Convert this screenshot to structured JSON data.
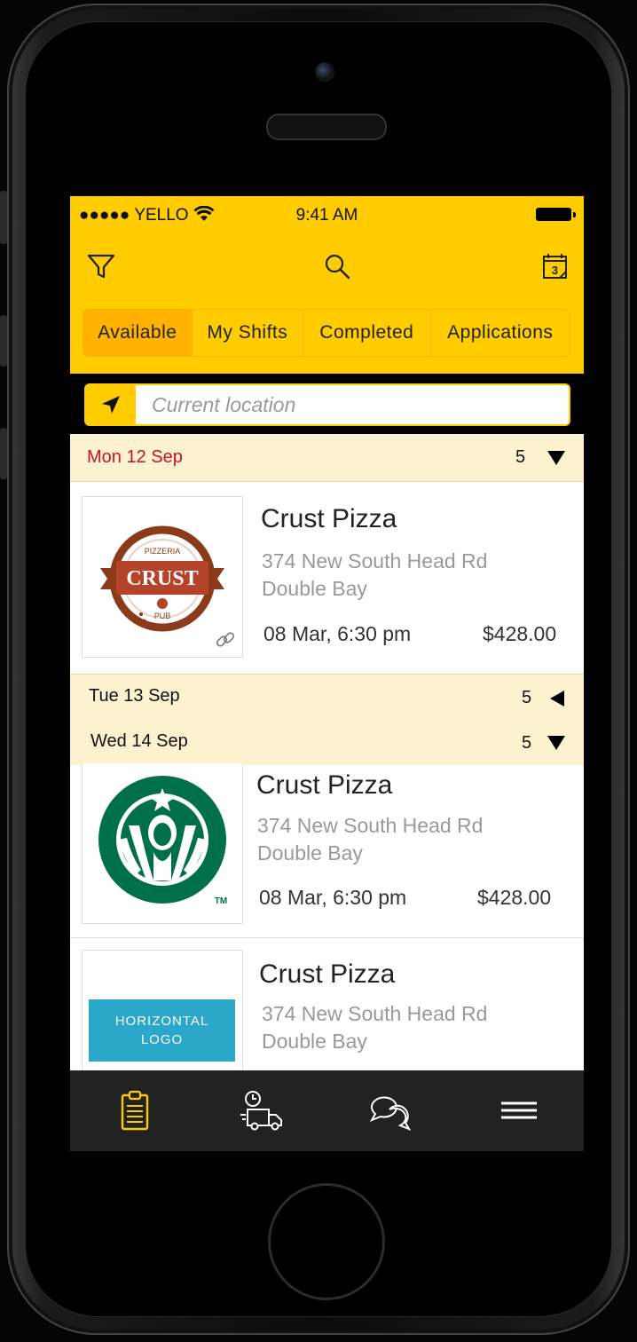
{
  "status_bar": {
    "carrier": "●●●●● YELLO",
    "time": "9:41 AM"
  },
  "toolbar": {
    "filter_icon": "filter-icon",
    "search_icon": "search-icon",
    "calendar_icon": "calendar-icon",
    "calendar_day": "3"
  },
  "tabs": [
    {
      "label": "Available",
      "active": true
    },
    {
      "label": "My Shifts",
      "active": false
    },
    {
      "label": "Completed",
      "active": false
    },
    {
      "label": "Applications",
      "active": false
    }
  ],
  "location": {
    "placeholder": "Current location"
  },
  "days": [
    {
      "label": "Mon 12 Sep",
      "count": "5",
      "expanded": true,
      "highlight": true
    },
    {
      "label": "Tue 13 Sep",
      "count": "5",
      "expanded": false,
      "highlight": false
    },
    {
      "label": "Wed 14 Sep",
      "count": "5",
      "expanded": true,
      "highlight": false
    }
  ],
  "shifts": [
    {
      "logo": "crust-pizza-logo",
      "logo_text": {
        "top": "PIZZERIA",
        "main": "CRUST",
        "bottom": "PUB"
      },
      "title": "Crust Pizza",
      "address_line1": "374 New South Head Rd",
      "address_line2": "Double Bay",
      "date": "08 Mar, 6:30 pm",
      "price": "$428.00",
      "linked": true
    },
    {
      "logo": "starbucks-logo",
      "logo_tm": "TM",
      "title": "Crust Pizza",
      "address_line1": "374 New South Head Rd",
      "address_line2": "Double Bay",
      "date": "08 Mar, 6:30 pm",
      "price": "$428.00"
    },
    {
      "logo": "horizontal-logo-placeholder",
      "logo_text": "HORIZONTAL LOGO",
      "title": "Crust Pizza",
      "address_line1": "374 New South Head Rd",
      "address_line2": "Double Bay"
    }
  ],
  "bottom_nav": [
    {
      "icon": "clipboard-icon",
      "active": true
    },
    {
      "icon": "delivery-truck-clock-icon",
      "active": false
    },
    {
      "icon": "chat-bubbles-icon",
      "active": false
    },
    {
      "icon": "menu-icon",
      "active": false
    }
  ],
  "colors": {
    "accent": "#ffcc00",
    "active_tab": "#ffb300",
    "day_header_bg": "#fdf2cf",
    "highlight_date": "#c8102e",
    "nav_bg": "#222222",
    "starbucks_green": "#00704a",
    "placeholder_blue": "#2aa7c9"
  }
}
